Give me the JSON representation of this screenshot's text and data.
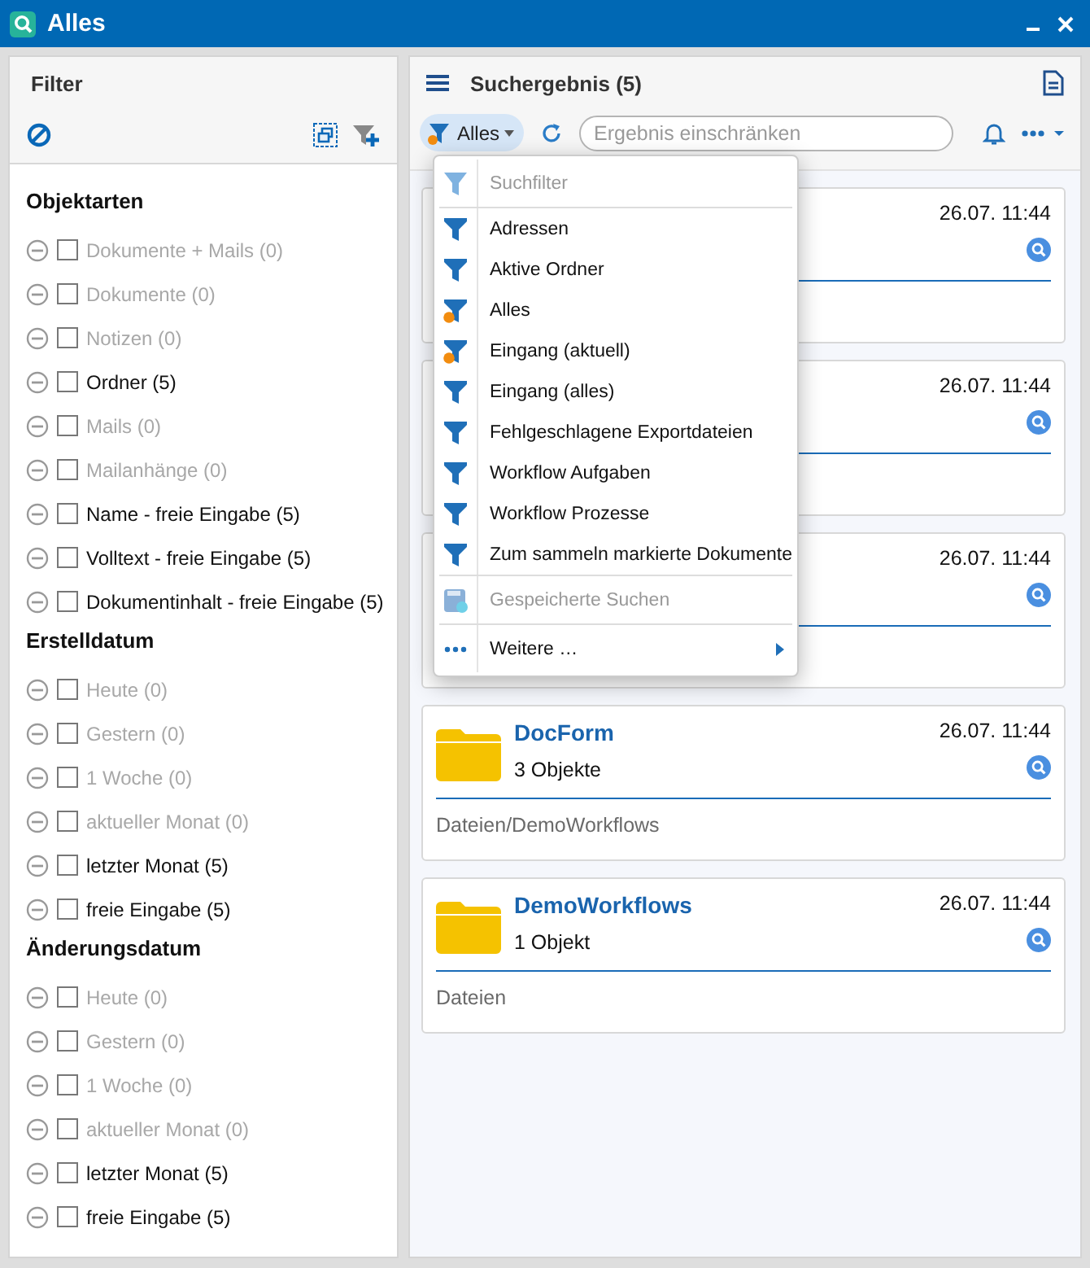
{
  "window": {
    "title": "Alles"
  },
  "filter": {
    "title": "Filter",
    "sections": [
      {
        "title": "Objektarten",
        "items": [
          {
            "label": "Dokumente + Mails (0)",
            "disabled": true,
            "checked": false
          },
          {
            "label": "Dokumente (0)",
            "disabled": true,
            "checked": false
          },
          {
            "label": "Notizen (0)",
            "disabled": true,
            "checked": false
          },
          {
            "label": "Ordner (5)",
            "disabled": false,
            "checked": false
          },
          {
            "label": "Mails (0)",
            "disabled": true,
            "checked": false
          },
          {
            "label": "Mailanhänge (0)",
            "disabled": true,
            "checked": false
          },
          {
            "label": "Name - freie Eingabe (5)",
            "disabled": false,
            "checked": false
          },
          {
            "label": "Volltext - freie Eingabe (5)",
            "disabled": false,
            "checked": false
          },
          {
            "label": "Dokumentinhalt - freie Eingabe (5)",
            "disabled": false,
            "checked": false
          }
        ]
      },
      {
        "title": "Erstelldatum",
        "items": [
          {
            "label": "Heute (0)",
            "disabled": true,
            "checked": false
          },
          {
            "label": "Gestern (0)",
            "disabled": true,
            "checked": false
          },
          {
            "label": "1 Woche (0)",
            "disabled": true,
            "checked": false
          },
          {
            "label": "aktueller Monat (0)",
            "disabled": true,
            "checked": false
          },
          {
            "label": "letzter Monat (5)",
            "disabled": false,
            "checked": false
          },
          {
            "label": "freie Eingabe (5)",
            "disabled": false,
            "checked": false
          }
        ]
      },
      {
        "title": "Änderungsdatum",
        "items": [
          {
            "label": "Heute (0)",
            "disabled": true,
            "checked": false
          },
          {
            "label": "Gestern (0)",
            "disabled": true,
            "checked": false
          },
          {
            "label": "1 Woche (0)",
            "disabled": true,
            "checked": false
          },
          {
            "label": "aktueller Monat (0)",
            "disabled": true,
            "checked": false
          },
          {
            "label": "letzter Monat (5)",
            "disabled": false,
            "checked": false
          },
          {
            "label": "freie Eingabe (5)",
            "disabled": false,
            "checked": false
          }
        ]
      }
    ]
  },
  "results": {
    "title": "Suchergebnis (5)",
    "filter_button": {
      "label": "Alles"
    },
    "search": {
      "placeholder": "Ergebnis einschränken"
    },
    "cards": [
      {
        "date": "26.07. 11:44"
      },
      {
        "date": "26.07. 11:44"
      },
      {
        "date": "26.07. 11:44"
      },
      {
        "title": "DocForm",
        "count": "3 Objekte",
        "date": "26.07. 11:44",
        "path": "Dateien/DemoWorkflows"
      },
      {
        "title": "DemoWorkflows",
        "count": "1 Objekt",
        "date": "26.07. 11:44",
        "path": "Dateien"
      }
    ]
  },
  "menu": {
    "items": [
      {
        "kind": "header",
        "label": "Suchfilter"
      },
      {
        "kind": "filter",
        "label": "Adressen",
        "dot": false
      },
      {
        "kind": "filter",
        "label": "Aktive Ordner",
        "dot": false
      },
      {
        "kind": "filter",
        "label": "Alles",
        "dot": true
      },
      {
        "kind": "filter",
        "label": "Eingang (aktuell)",
        "dot": true
      },
      {
        "kind": "filter",
        "label": "Eingang (alles)",
        "dot": false
      },
      {
        "kind": "filter",
        "label": "Fehlgeschlagene Exportdateien",
        "dot": false
      },
      {
        "kind": "filter",
        "label": "Workflow Aufgaben",
        "dot": false
      },
      {
        "kind": "filter",
        "label": "Workflow Prozesse",
        "dot": false
      },
      {
        "kind": "filter",
        "label": "Zum sammeln markierte Dokumente",
        "dot": false
      },
      {
        "kind": "saved",
        "label": "Gespeicherte Suchen"
      },
      {
        "kind": "more",
        "label": "Weitere …"
      }
    ]
  }
}
